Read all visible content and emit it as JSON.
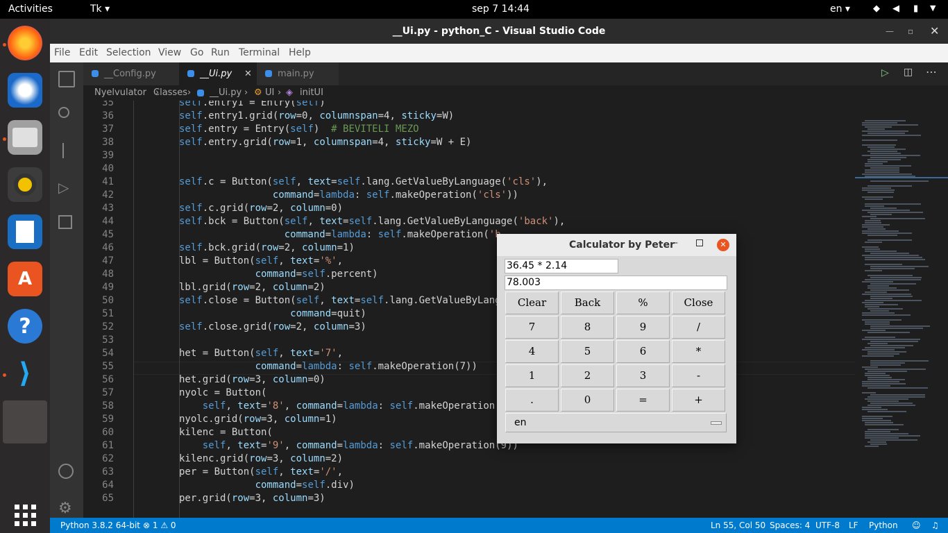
{
  "topbar": {
    "activities": "Activities",
    "app": "Tk ▾",
    "clock": "sep 7  14:44",
    "lang": "en ▾"
  },
  "dock": {
    "apps": [
      "firefox-icon",
      "thunderbird-icon",
      "files-icon",
      "rhythmbox-icon",
      "writer-icon",
      "software-icon",
      "help-icon",
      "vscode-icon",
      "tk-window-icon"
    ]
  },
  "window": {
    "title": "__Ui.py - python_C - Visual Studio Code"
  },
  "menu": [
    "File",
    "Edit",
    "Selection",
    "View",
    "Go",
    "Run",
    "Terminal",
    "Help"
  ],
  "tabs": [
    {
      "label": "__Config.py"
    },
    {
      "label": "__Ui.py"
    },
    {
      "label": "main.py"
    }
  ],
  "breadcrumb": {
    "a": "Nyelvulator",
    "b": "Classes",
    "c": "__Ui.py",
    "d": "UI",
    "e": "initUI"
  },
  "editor": {
    "line_numbers": [
      "35",
      "36",
      "37",
      "38",
      "39",
      "40",
      "41",
      "42",
      "43",
      "44",
      "45",
      "46",
      "47",
      "48",
      "49",
      "50",
      "51",
      "52",
      "53",
      "54",
      "55",
      "56",
      "57",
      "58",
      "59",
      "60",
      "61",
      "62",
      "63",
      "64",
      "65"
    ],
    "lines": [
      "self.entry1 = Entry(self)",
      "self.entry1.grid(row=0, columnspan=4, sticky=W)",
      "self.entry = Entry(self)  # BEVITELI MEZO",
      "self.entry.grid(row=1, columnspan=4, sticky=W + E)",
      "",
      "",
      "self.c = Button(self, text=self.lang.GetValueByLanguage('cls'),",
      "                command=lambda: self.makeOperation('cls'))",
      "self.c.grid(row=2, column=0)",
      "self.bck = Button(self, text=self.lang.GetValueByLanguage('back'),",
      "                  command=lambda: self.makeOperation('b",
      "self.bck.grid(row=2, column=1)",
      "lbl = Button(self, text='%',",
      "             command=self.percent)",
      "lbl.grid(row=2, column=2)",
      "self.close = Button(self, text=self.lang.GetValueByLang",
      "                   command=quit)",
      "self.close.grid(row=2, column=3)",
      "",
      "het = Button(self, text='7',",
      "             command=lambda: self.makeOperation(7))",
      "het.grid(row=3, column=0)",
      "nyolc = Button(",
      "    self, text='8', command=lambda: self.makeOperation(",
      "nyolc.grid(row=3, column=1)",
      "kilenc = Button(",
      "    self, text='9', command=lambda: self.makeOperation(9))",
      "kilenc.grid(row=3, column=2)",
      "per = Button(self, text='/',",
      "             command=self.div)",
      "per.grid(row=3, column=3)"
    ]
  },
  "status": {
    "python": "Python 3.8.2 64-bit",
    "problems": "⊗ 1 ⚠ 0",
    "position": "Ln 55, Col 50",
    "spaces": "Spaces: 4",
    "encoding": "UTF-8",
    "eol": "LF",
    "language": "Python"
  },
  "calculator": {
    "title": "Calculator by Peter",
    "expression": "36.45 * 2.14",
    "result": "78.003",
    "buttons": [
      "Clear",
      "Back",
      "%",
      "Close",
      "7",
      "8",
      "9",
      "/",
      "4",
      "5",
      "6",
      "*",
      "1",
      "2",
      "3",
      "-",
      ".",
      "0",
      "=",
      "+"
    ],
    "language": "en"
  }
}
